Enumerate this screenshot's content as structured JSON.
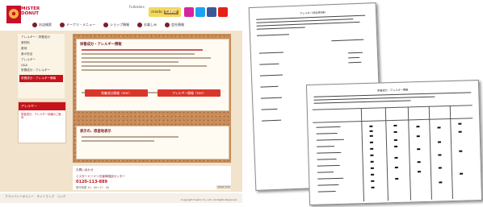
{
  "site": {
    "logo_text": "MISTER DONUT",
    "top_strip": "Fullcolors",
    "card_banner": {
      "prefix": "misdo",
      "word": "CARD"
    },
    "social": [
      "instagram",
      "twitter",
      "facebook",
      "youtube"
    ],
    "nav": [
      "お店検索",
      "ドーナツ・メニュー",
      "ショップ情報",
      "お楽しみ",
      "会社情報"
    ],
    "sidebar": {
      "items": [
        "アレルギー・栄養成分",
        "原材料",
        "産地",
        "食の安全",
        "アレルギー",
        "Q&A",
        "栄養成分・アレルギー"
      ],
      "active": "栄養成分・アレルギー情報"
    },
    "side_box": {
      "header": "アレルギー",
      "text": "栄養成分・アレルギー情報のご案内"
    },
    "panel1": {
      "title": "栄養成分・アレルギー情報",
      "button1": "栄養成分情報（PDF）",
      "button2": "アレルギー情報（PDF）"
    },
    "panel2": {
      "title": "表示の、原産地表示"
    },
    "contact": {
      "line1": "お問い合わせ",
      "line2": "ミスタードーナツお客様相談センター",
      "tel": "0120-113-889",
      "hours": "受付時間 10：00～17：00"
    },
    "page_top": "PAGE TOP",
    "footer_links": "プライバシーポリシー　サイトマップ　リンク",
    "copyright": "Copyright Duskin Co., Ltd. All Rights Reserved."
  },
  "documents": {
    "back_title": "アレルギー特定原材料",
    "front_title": "栄養成分・アレルギー情報"
  }
}
